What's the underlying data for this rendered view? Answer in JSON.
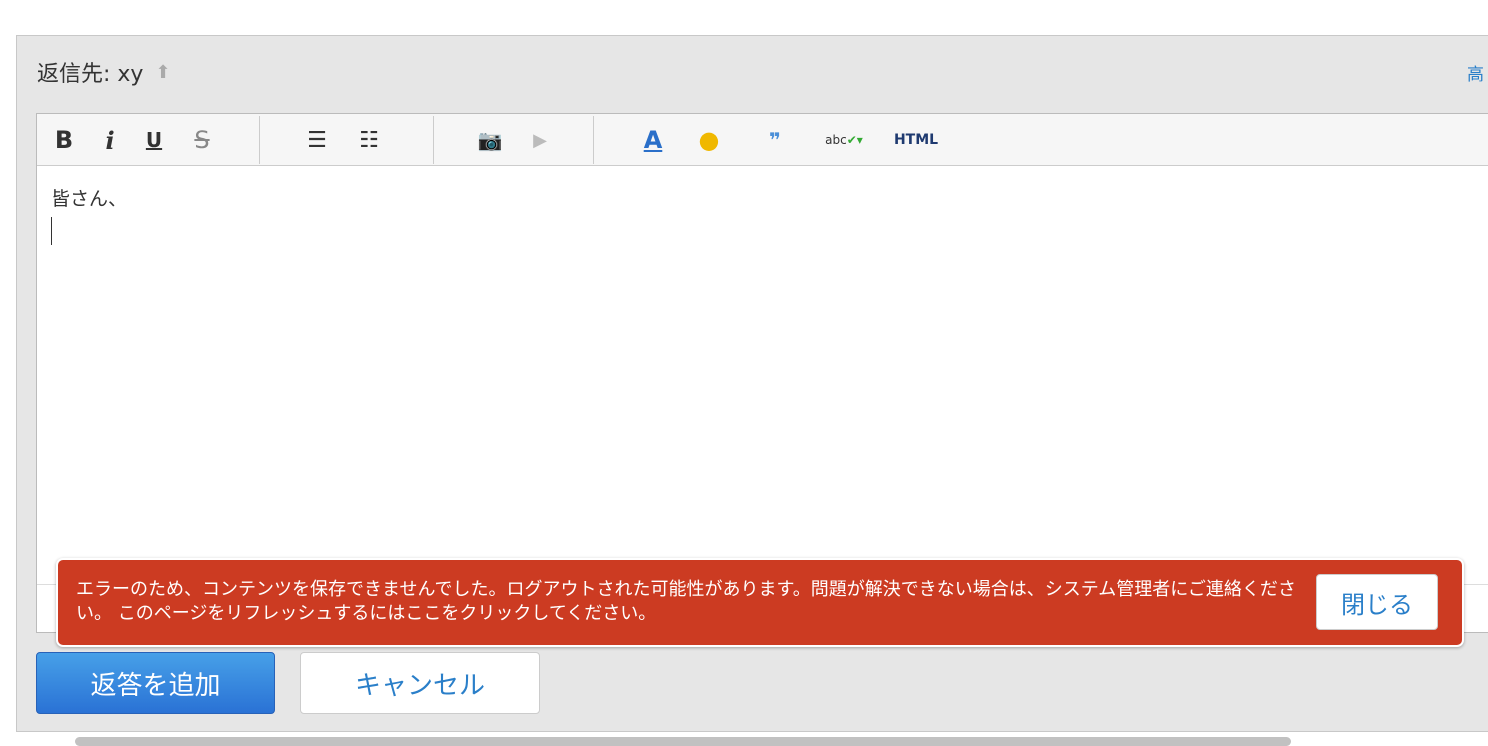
{
  "header": {
    "reply_to_label": "返信先: xy",
    "advanced_link": "高"
  },
  "toolbar": {
    "bold": "B",
    "italic": "i",
    "underline": "U",
    "strike": "S",
    "html": "HTML",
    "spell": "abc"
  },
  "editor": {
    "content": "皆さん、"
  },
  "error": {
    "message": "エラーのため、コンテンツを保存できませんでした。ログアウトされた可能性があります。問題が解決できない場合は、システム管理者にご連絡ください。 このページをリフレッシュするにはここをクリックしてください。",
    "close_label": "閉じる",
    "color": "#cc3b22"
  },
  "buttons": {
    "add": "返答を追加",
    "cancel": "キャンセル"
  }
}
